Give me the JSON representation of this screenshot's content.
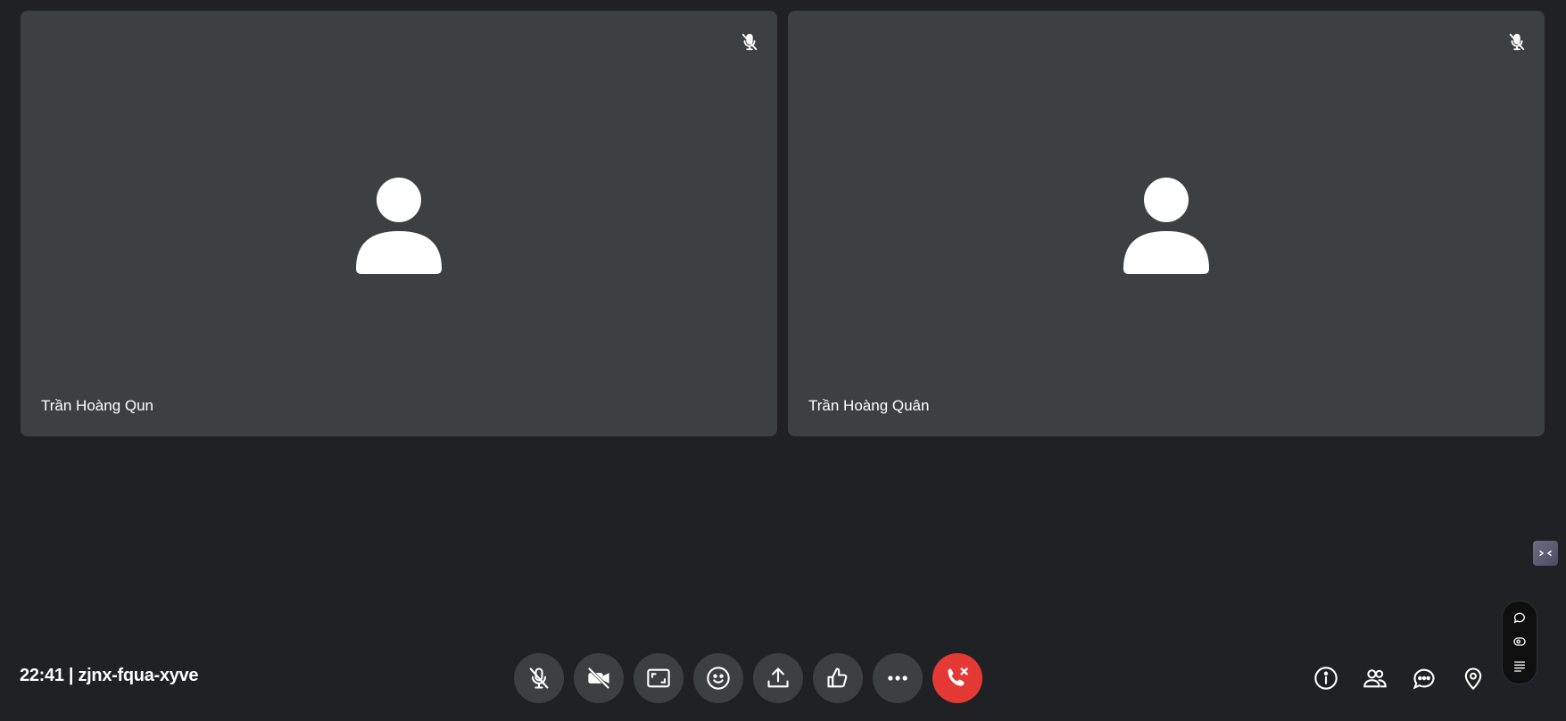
{
  "participants": [
    {
      "name": "Trần Hoàng Qun",
      "mic_icon": "mic-off-icon",
      "avatar_icon": "person-icon"
    },
    {
      "name": "Trần Hoàng Quân",
      "mic_icon": "mic-off-icon",
      "avatar_icon": "person-icon"
    }
  ],
  "meeting": {
    "info": "22:41 | zjnx-fqua-xyve"
  },
  "controls": [
    {
      "icon": "mic-off-icon"
    },
    {
      "icon": "camera-off-icon"
    },
    {
      "icon": "screen-frame-icon"
    },
    {
      "icon": "emoji-icon"
    },
    {
      "icon": "share-upload-icon"
    },
    {
      "icon": "raise-hand-icon"
    },
    {
      "icon": "more-icon"
    },
    {
      "icon": "end-call-icon",
      "color": "#e53935"
    }
  ],
  "right_controls": [
    {
      "icon": "info-icon"
    },
    {
      "icon": "people-icon"
    },
    {
      "icon": "chat-icon"
    },
    {
      "icon": "location-icon"
    }
  ],
  "colors": {
    "background": "#202124",
    "tile": "#3c4043",
    "end_call": "#e53935"
  }
}
